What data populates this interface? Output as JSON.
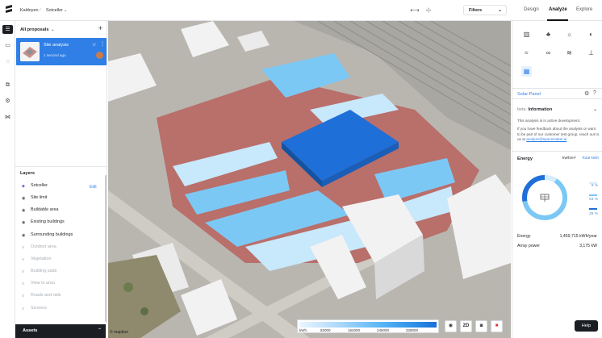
{
  "header": {
    "breadcrumb_org": "Kaldoyen",
    "breadcrumb_project": "Sotceller",
    "filters_label": "Filters",
    "tabs": [
      "Design",
      "Analyze",
      "Explore"
    ],
    "active_tab": "Analyze"
  },
  "proposals": {
    "title": "All proposals",
    "items": [
      {
        "name": "Site analysis",
        "time": "1 second ago",
        "starred": true
      }
    ]
  },
  "layers": {
    "title": "Layers",
    "edit_label": "Edit",
    "items": [
      {
        "label": "Sotceller",
        "active": true,
        "icon": "diamond-icon"
      },
      {
        "label": "Site limit",
        "active": true,
        "icon": "eye-icon"
      },
      {
        "label": "Buildable area",
        "active": true,
        "icon": "eye-icon"
      },
      {
        "label": "Existing buildings",
        "active": true,
        "icon": "eye-icon"
      },
      {
        "label": "Surrounding buildings",
        "active": true,
        "icon": "eye-icon"
      },
      {
        "label": "Outdoor area",
        "active": false,
        "icon": "eye-off-icon"
      },
      {
        "label": "Vegetation",
        "active": false,
        "icon": "eye-off-icon"
      },
      {
        "label": "Building pads",
        "active": false,
        "icon": "eye-off-icon"
      },
      {
        "label": "View to area",
        "active": false,
        "icon": "eye-off-icon"
      },
      {
        "label": "Roads and rails",
        "active": false,
        "icon": "eye-off-icon"
      },
      {
        "label": "Screens",
        "active": false,
        "icon": "eye-off-icon"
      }
    ],
    "assets_label": "Assets"
  },
  "map": {
    "legend_values": [
      "kWh",
      "82000",
      "164000",
      "246000",
      "328000"
    ],
    "mode_2d_label": "2D",
    "attribution": "© mapbox",
    "colors": {
      "roof_low": "#c8e8fb",
      "roof_mid": "#7cc8f5",
      "roof_high": "#1f6fd9",
      "ground": "#b96f6a",
      "building": "#f2f2f2"
    }
  },
  "analysis": {
    "panel_title": "Solar Panel",
    "section_tag": "beta",
    "section_title": "Information",
    "info_text_1": "This analysis is in active development.",
    "info_text_2": "If you have feedback about the analysis or want to be part of our customer test group, reach out to us at",
    "info_email": "analyze@spacemaker.ai",
    "energy_title": "Energy",
    "unit_options": [
      "kWh/m²",
      "Total kWh"
    ],
    "active_unit": "Total kWh",
    "donut_percentages": [
      {
        "label": "9 %",
        "value": 9,
        "color": "#d6ecfb"
      },
      {
        "label": "63 %",
        "value": 63,
        "color": "#7cc8f5"
      },
      {
        "label": "28 %",
        "value": 28,
        "color": "#1f6fd9"
      }
    ],
    "stats": [
      {
        "label": "Energy",
        "value": "1,459,715 kWh/year"
      },
      {
        "label": "Array power",
        "value": "3,175 kW"
      }
    ]
  },
  "help_label": "Help"
}
